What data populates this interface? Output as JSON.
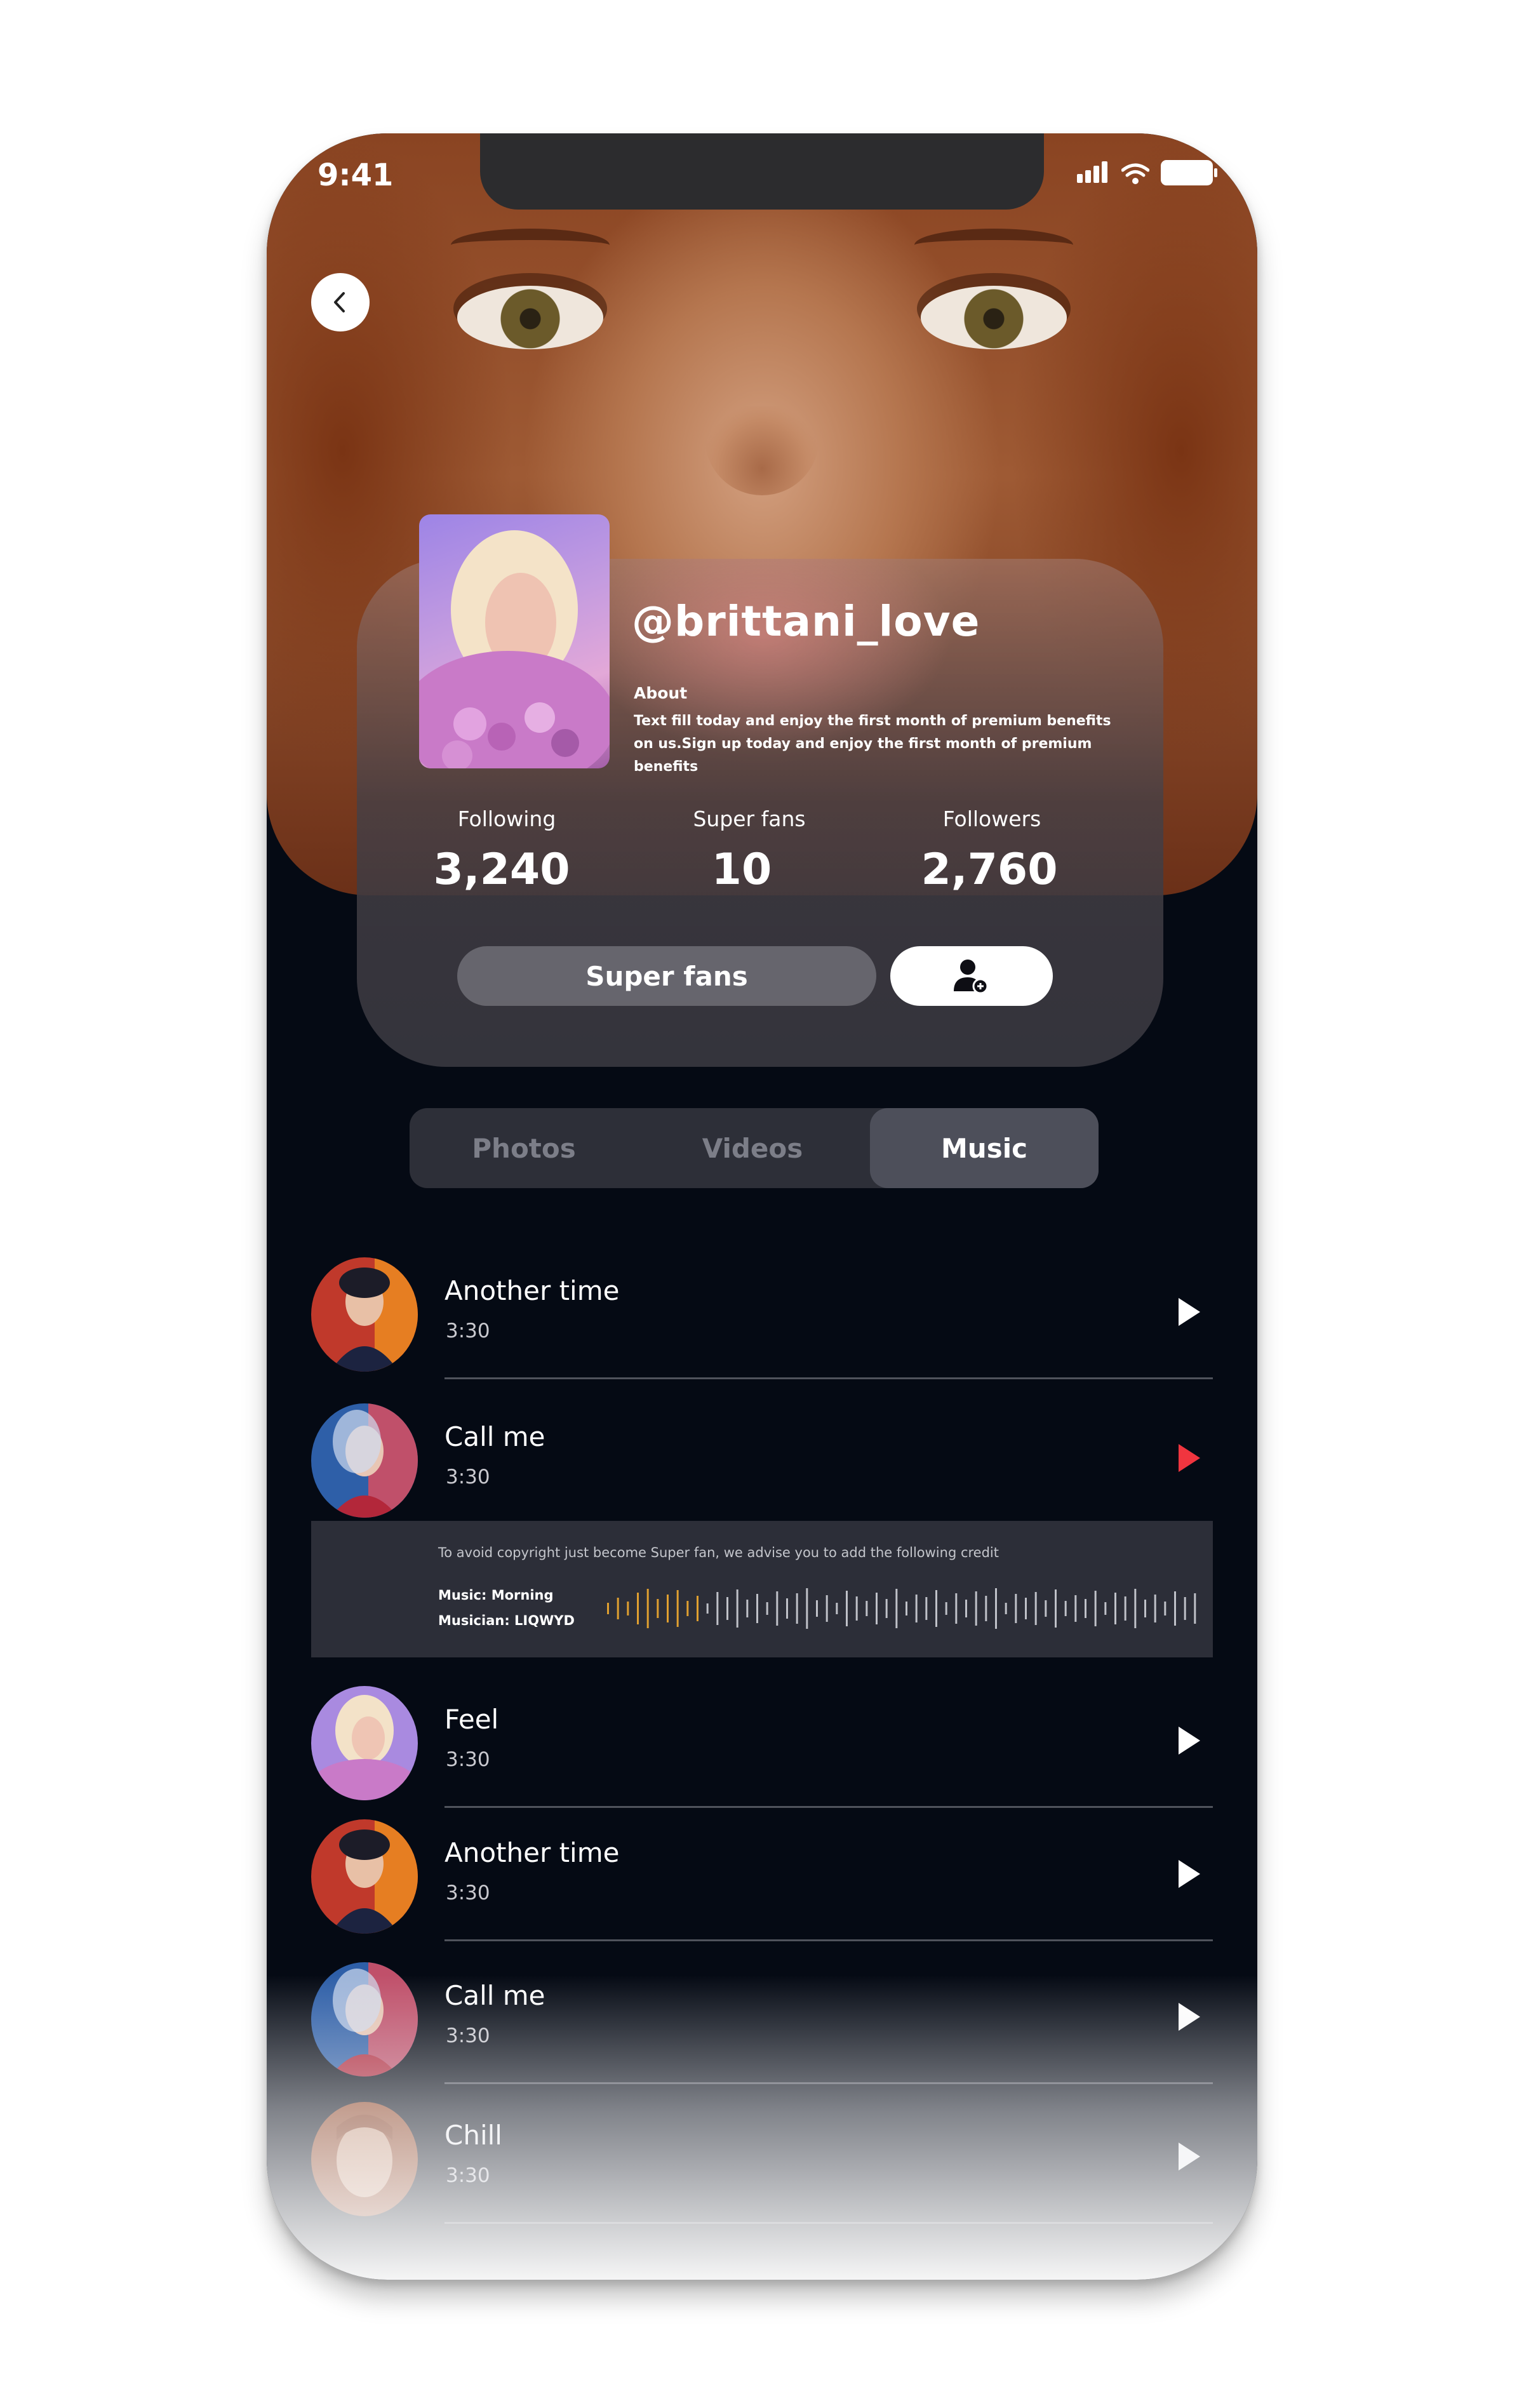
{
  "status": {
    "time": "9:41"
  },
  "profile": {
    "username": "@brittani_love",
    "about_heading": "About",
    "about_text": "Text fill today and enjoy the first month of premium benefits on us.Sign up today and enjoy the first month of premium benefits",
    "stats": [
      {
        "label": "Following",
        "value": "3,240"
      },
      {
        "label": "Super fans",
        "value": "10"
      },
      {
        "label": "Followers",
        "value": "2,760"
      }
    ],
    "superfans_button": "Super fans"
  },
  "tabs": [
    {
      "label": "Photos",
      "active": false
    },
    {
      "label": "Videos",
      "active": false
    },
    {
      "label": "Music",
      "active": true
    }
  ],
  "tracks": [
    {
      "title": "Another time",
      "duration": "3:30",
      "playing": false
    },
    {
      "title": "Call me",
      "duration": "3:30",
      "playing": true
    },
    {
      "title": "Feel",
      "duration": "3:30",
      "playing": false
    },
    {
      "title": "Another time",
      "duration": "3:30",
      "playing": false
    },
    {
      "title": "Call me",
      "duration": "3:30",
      "playing": false
    },
    {
      "title": "Chill",
      "duration": "3:30",
      "playing": false
    }
  ],
  "credit": {
    "note": "To avoid copyright just become Super fan, we advise you to add the following credit",
    "music": "Music: Morning",
    "musician": "Musician: LIQWYD"
  },
  "colors": {
    "background": "#050a14",
    "accent_play": "#f0353f",
    "waveform_played": "#e0a030"
  }
}
